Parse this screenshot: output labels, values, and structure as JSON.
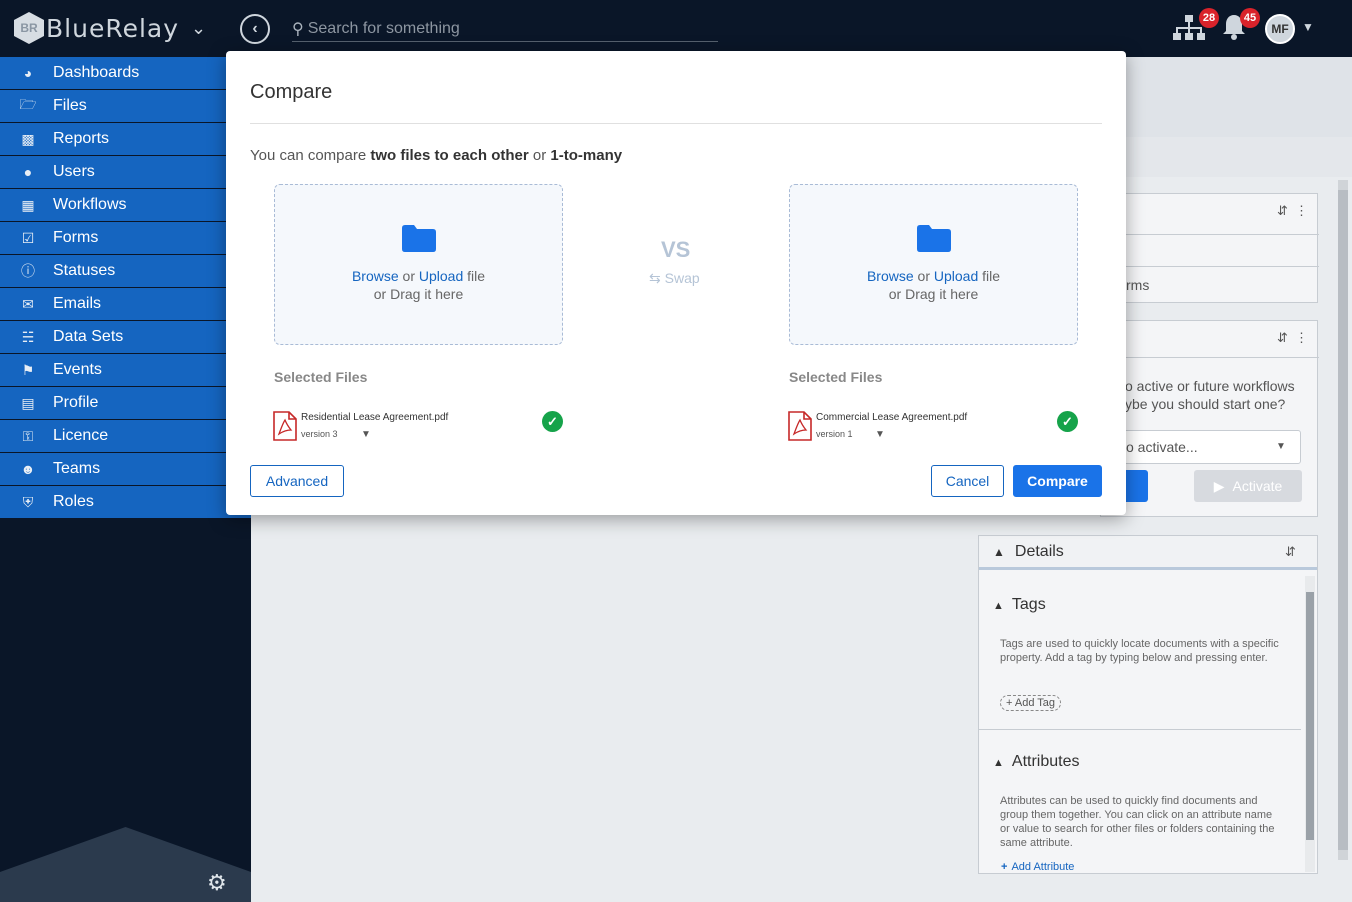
{
  "app": {
    "logo_text": "BlueRelay",
    "logo_mark": "BR",
    "search_placeholder": "Search for something",
    "workflow_badge": "28",
    "notification_badge": "45",
    "avatar_initials": "MF"
  },
  "sidebar": {
    "items": [
      {
        "label": "Dashboards",
        "icon": "dashboard-icon"
      },
      {
        "label": "Files",
        "icon": "folder-open-icon"
      },
      {
        "label": "Reports",
        "icon": "chart-icon"
      },
      {
        "label": "Users",
        "icon": "user-icon"
      },
      {
        "label": "Workflows",
        "icon": "sitemap-icon"
      },
      {
        "label": "Forms",
        "icon": "checkbox-icon"
      },
      {
        "label": "Statuses",
        "icon": "info-icon"
      },
      {
        "label": "Emails",
        "icon": "envelope-icon"
      },
      {
        "label": "Data Sets",
        "icon": "database-icon"
      },
      {
        "label": "Events",
        "icon": "flag-icon"
      },
      {
        "label": "Profile",
        "icon": "id-card-icon"
      },
      {
        "label": "Licence",
        "icon": "key-icon"
      },
      {
        "label": "Teams",
        "icon": "users-icon"
      },
      {
        "label": "Roles",
        "icon": "shield-icon"
      }
    ]
  },
  "background": {
    "forms_partial": "rms",
    "workflow_text_1": "o active or future workflows",
    "workflow_text_2": "ybe you should start one?",
    "select_partial": "o activate...",
    "activate_label": "Activate"
  },
  "modal": {
    "title": "Compare",
    "desc_prefix": "You can compare ",
    "desc_bold1": "two files to each other",
    "desc_mid": " or ",
    "desc_bold2": "1-to-many",
    "browse": "Browse",
    "or": " or ",
    "upload": "Upload",
    "file_word": " file",
    "drag_text": "or Drag it here",
    "vs": "VS",
    "swap": "Swap",
    "selected_files_label": "Selected Files",
    "left_file": {
      "name": "Residential Lease Agreement.pdf",
      "version": "version 3"
    },
    "right_file": {
      "name": "Commercial Lease Agreement.pdf",
      "version": "version 1"
    },
    "advanced_label": "Advanced",
    "cancel_label": "Cancel",
    "compare_label": "Compare"
  },
  "details": {
    "title": "Details",
    "tags_title": "Tags",
    "tags_text": "Tags are used to quickly locate documents with a specific property. Add a tag by typing below and pressing enter.",
    "add_tag": "+ Add Tag",
    "attributes_title": "Attributes",
    "attributes_text": "Attributes can be used to quickly find documents and group them together. You can click on an attribute name or value to search for other files or folders containing the same attribute.",
    "add_attribute": "Add Attribute"
  },
  "colors": {
    "nav_bg": "#1565c0",
    "dark_bg": "#0a1628",
    "primary": "#1a73e8",
    "success": "#16a34a",
    "badge": "#d9232b"
  }
}
